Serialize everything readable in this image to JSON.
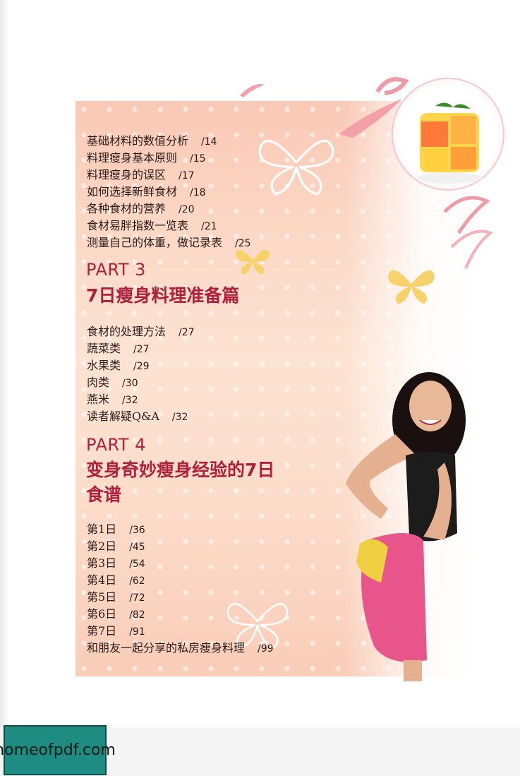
{
  "section2": {
    "items": [
      {
        "label": "基础材料的数值分析",
        "page": "/14"
      },
      {
        "label": "料理瘦身基本原则",
        "page": "/15"
      },
      {
        "label": "料理瘦身的误区",
        "page": "/17"
      },
      {
        "label": "如何选择新鲜食材",
        "page": "/18"
      },
      {
        "label": "各种食材的营养",
        "page": "/20"
      },
      {
        "label": "食材易胖指数一览表",
        "page": "/21"
      },
      {
        "label": "测量自己的体重，做记录表",
        "page": "/25"
      }
    ]
  },
  "part3": {
    "label": "PART 3",
    "title": "7日瘦身料理准备篇",
    "items": [
      {
        "label": "食材的处理方法",
        "page": "/27"
      },
      {
        "label": "蔬菜类",
        "page": "/27"
      },
      {
        "label": "水果类",
        "page": "/29"
      },
      {
        "label": "肉类",
        "page": "/30"
      },
      {
        "label": "燕米",
        "page": "/32"
      },
      {
        "label": "读者解疑Q&A",
        "page": "/32"
      }
    ]
  },
  "part4": {
    "label": "PART 4",
    "title_line1": "变身奇妙瘦身经验的7日",
    "title_line2": "食谱",
    "items": [
      {
        "label": "第1日",
        "page": "/36"
      },
      {
        "label": "第2日",
        "page": "/45"
      },
      {
        "label": "第3日",
        "page": "/54"
      },
      {
        "label": "第4日",
        "page": "/62"
      },
      {
        "label": "第5日",
        "page": "/72"
      },
      {
        "label": "第6日",
        "page": "/82"
      },
      {
        "label": "第7日",
        "page": "/91"
      },
      {
        "label": "和朋友一起分享的私房瘦身料理",
        "page": "/99"
      }
    ]
  },
  "watermark": "homeofpdf.com",
  "colors": {
    "accent": "#b0203c",
    "panel": "#fbd6c3",
    "watermark_bg": "#1e8c80"
  }
}
